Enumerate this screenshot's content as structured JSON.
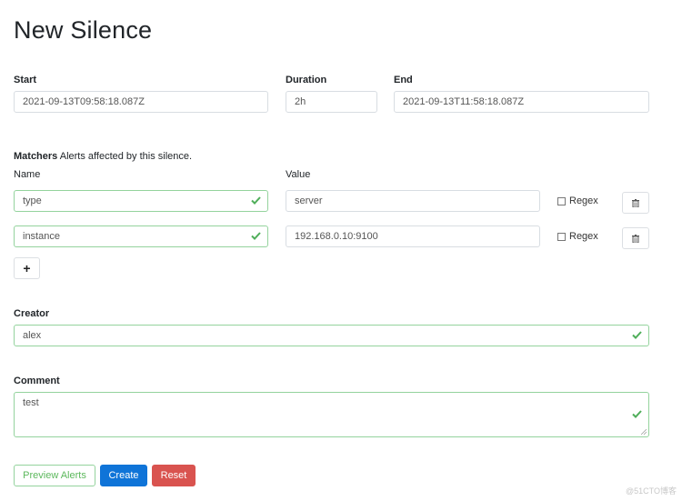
{
  "page": {
    "title": "New Silence"
  },
  "time": {
    "start_label": "Start",
    "start_value": "2021-09-13T09:58:18.087Z",
    "duration_label": "Duration",
    "duration_value": "2h",
    "end_label": "End",
    "end_value": "2021-09-13T11:58:18.087Z"
  },
  "matchers": {
    "heading": "Matchers",
    "description": "Alerts affected by this silence.",
    "name_header": "Name",
    "value_header": "Value",
    "regex_label": "Regex",
    "add_button_label": "+",
    "rows": [
      {
        "name": "type",
        "value": "server",
        "regex": false,
        "name_valid": true
      },
      {
        "name": "instance",
        "value": "192.168.0.10:9100",
        "regex": false,
        "name_valid": true
      }
    ]
  },
  "creator": {
    "label": "Creator",
    "value": "alex",
    "valid": true
  },
  "comment": {
    "label": "Comment",
    "value": "test",
    "valid": true
  },
  "actions": {
    "preview_label": "Preview Alerts",
    "create_label": "Create",
    "reset_label": "Reset"
  },
  "colors": {
    "valid_green": "#5cb85c",
    "primary_blue": "#0f74d8",
    "danger_red": "#d9534f"
  },
  "watermark": "@51CTO博客"
}
